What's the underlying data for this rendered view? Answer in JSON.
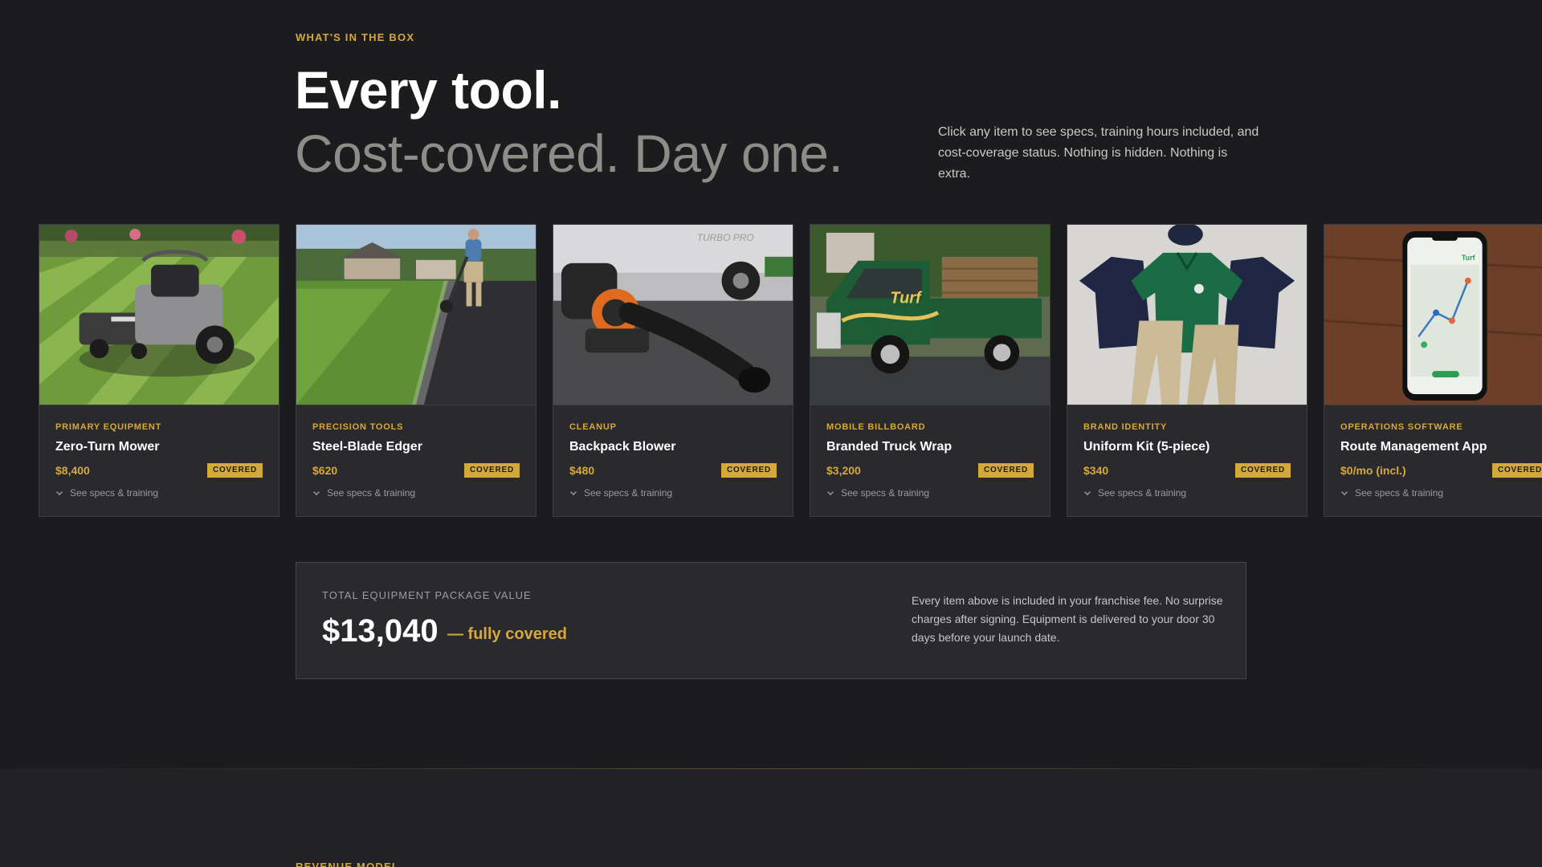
{
  "section": {
    "eyebrow": "WHAT'S IN THE BOX",
    "headline": "Every tool.",
    "subheadline": "Cost-covered. Day one.",
    "intro": "Click any item to see specs, training hours included, and cost-coverage status. Nothing is hidden. Nothing is extra."
  },
  "cards": [
    {
      "category": "PRIMARY EQUIPMENT",
      "title": "Zero-Turn Mower",
      "price": "$8,400",
      "badge": "COVERED",
      "toggle": "See specs & training",
      "image": "zero-turn-mower-photo"
    },
    {
      "category": "PRECISION TOOLS",
      "title": "Steel-Blade Edger",
      "price": "$620",
      "badge": "COVERED",
      "toggle": "See specs & training",
      "image": "edger-photo"
    },
    {
      "category": "CLEANUP",
      "title": "Backpack Blower",
      "price": "$480",
      "badge": "COVERED",
      "toggle": "See specs & training",
      "image": "backpack-blower-photo",
      "image_text": "TURBO PRO"
    },
    {
      "category": "MOBILE BILLBOARD",
      "title": "Branded Truck Wrap",
      "price": "$3,200",
      "badge": "COVERED",
      "toggle": "See specs & training",
      "image": "truck-wrap-photo",
      "image_text": "Turf"
    },
    {
      "category": "BRAND IDENTITY",
      "title": "Uniform Kit (5-piece)",
      "price": "$340",
      "badge": "COVERED",
      "toggle": "See specs & training",
      "image": "uniform-kit-photo"
    },
    {
      "category": "OPERATIONS SOFTWARE",
      "title": "Route Management App",
      "price": "$0/mo (incl.)",
      "badge": "COVERED",
      "toggle": "See specs & training",
      "image": "route-app-photo",
      "image_text": "Turf"
    }
  ],
  "summary": {
    "label": "TOTAL EQUIPMENT PACKAGE VALUE",
    "value": "$13,040",
    "covered": "— fully covered",
    "note": "Every item above is included in your franchise fee. No surprise charges after signing. Equipment is delivered to your door 30 days before your launch date."
  },
  "next_section": {
    "eyebrow": "REVENUE MODEL"
  },
  "colors": {
    "background": "#1c1c1f",
    "accent": "#d5a83c",
    "card": "#2a2a2e"
  }
}
